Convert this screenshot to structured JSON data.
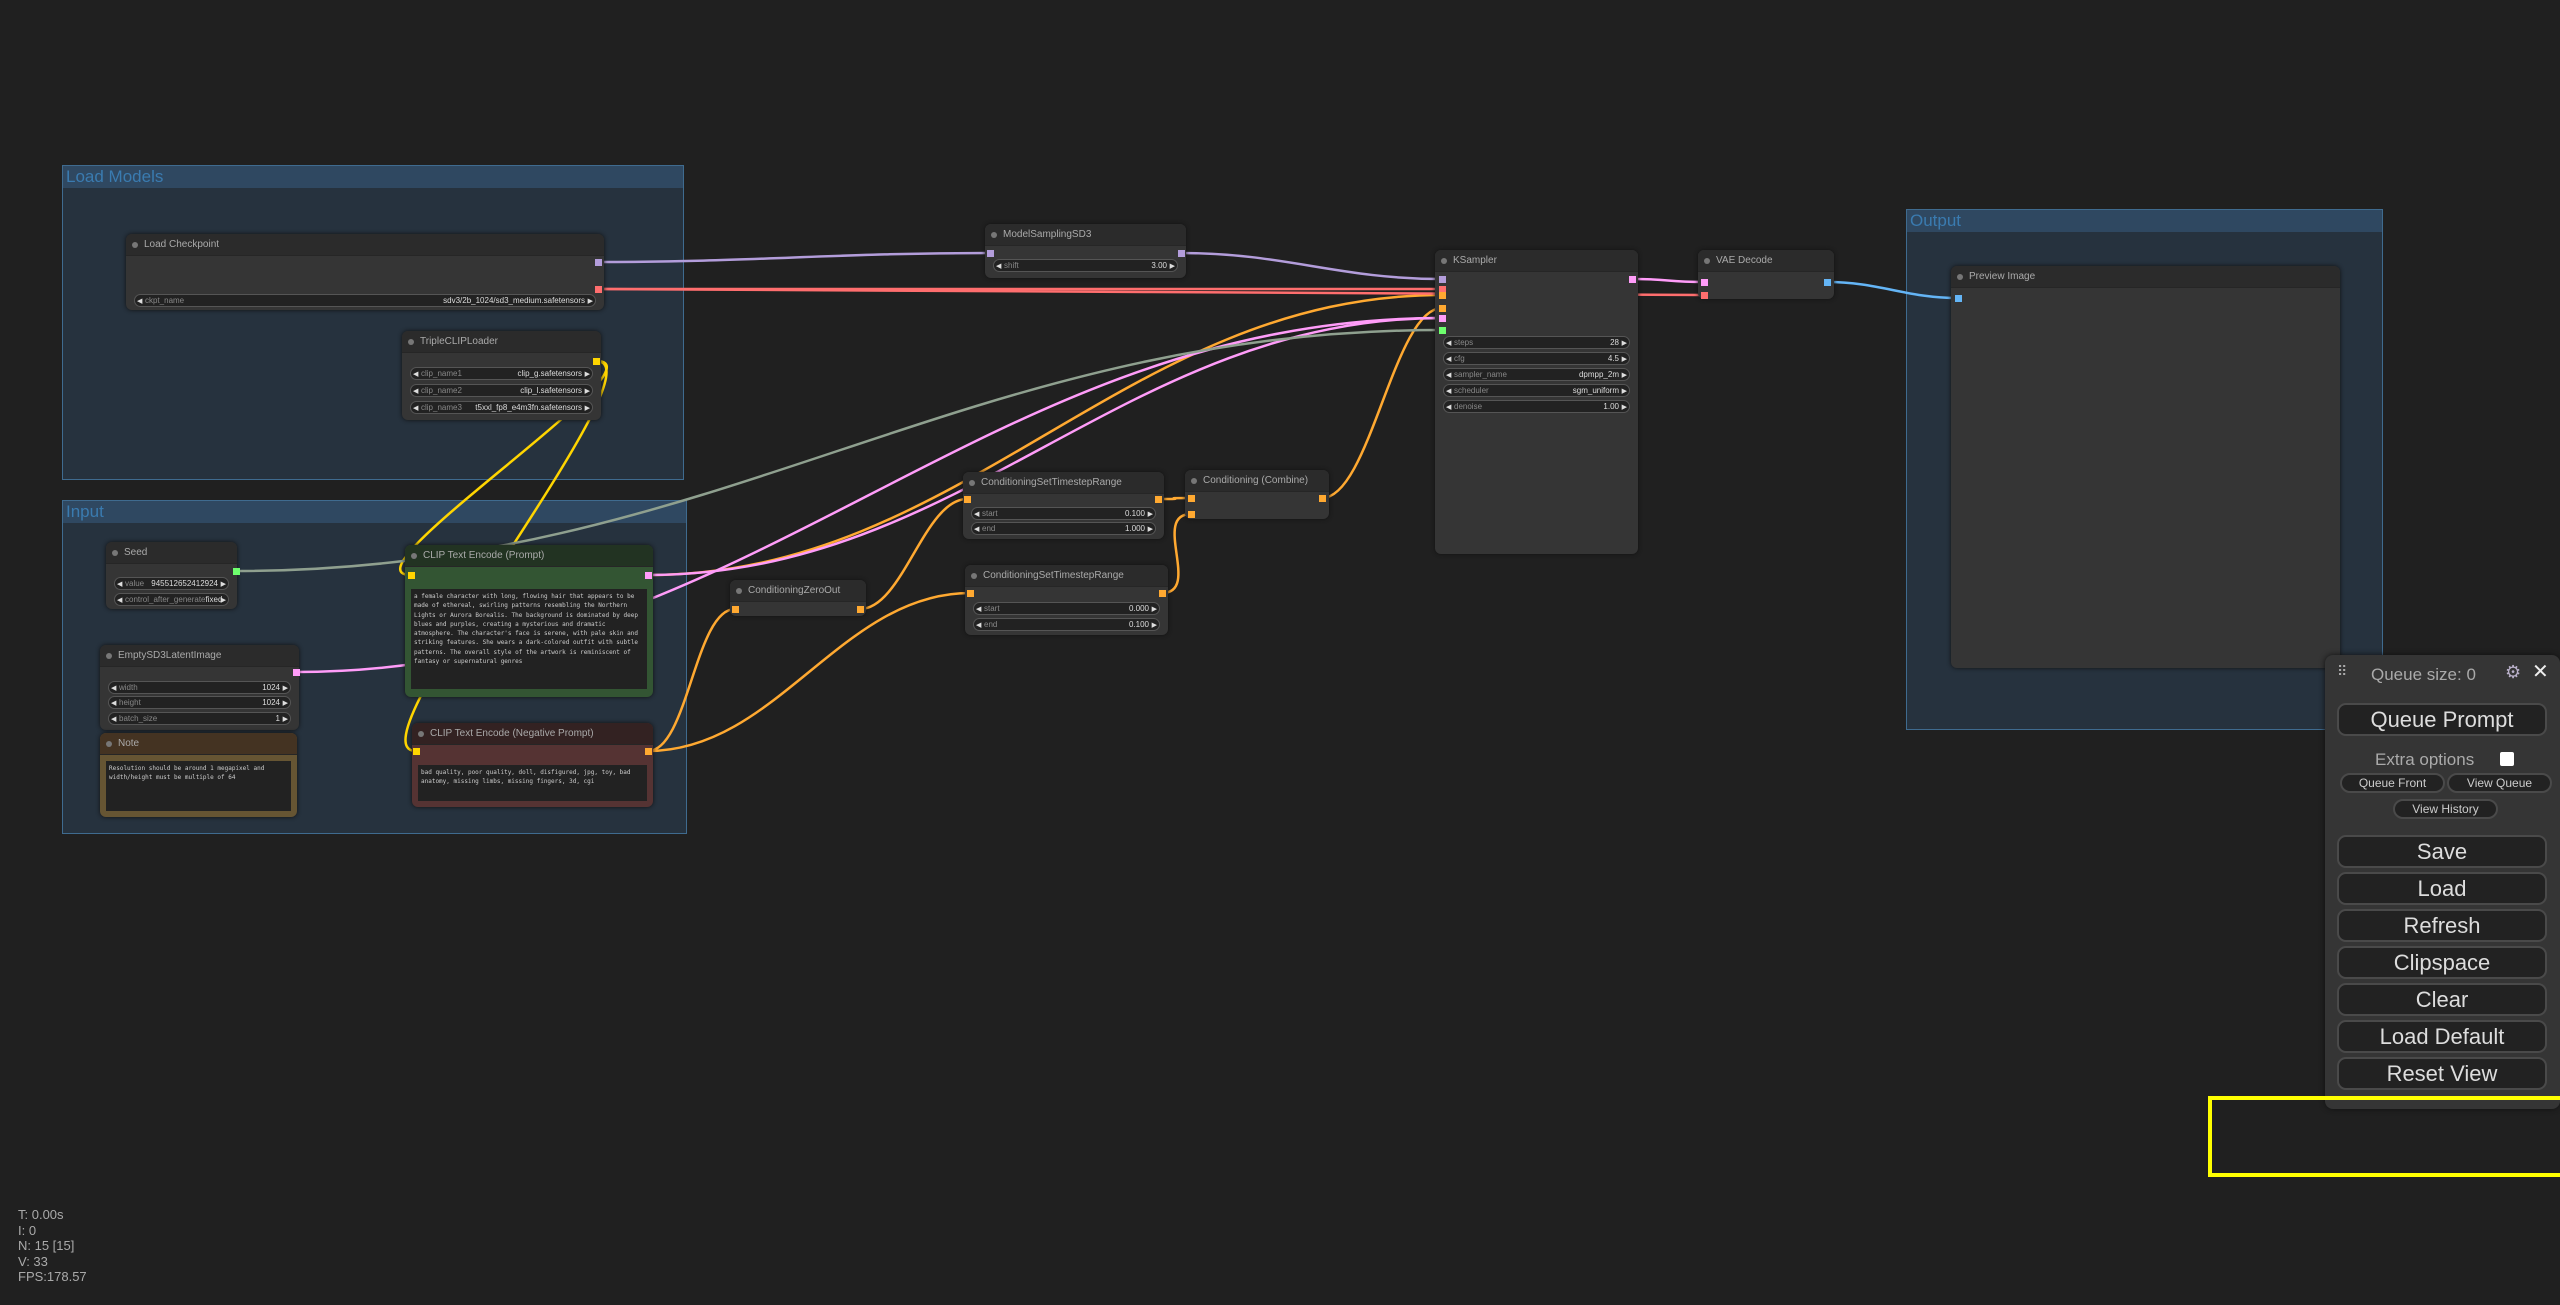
{
  "groups": {
    "load_models": "Load Models",
    "input": "Input",
    "output": "Output"
  },
  "nodes": {
    "load_checkpoint": {
      "title": "Load Checkpoint",
      "ckpt_name_label": "ckpt_name",
      "ckpt_name": "sdv3/2b_1024/sd3_medium.safetensors"
    },
    "triple_clip": {
      "title": "TripleCLIPLoader",
      "clip_name1_label": "clip_name1",
      "clip_name1": "clip_g.safetensors",
      "clip_name2_label": "clip_name2",
      "clip_name2": "clip_l.safetensors",
      "clip_name3_label": "clip_name3",
      "clip_name3": "t5xxl_fp8_e4m3fn.safetensors"
    },
    "seed": {
      "title": "Seed",
      "value_label": "value",
      "value": "945512652412924",
      "control_label": "control_after_generate",
      "control": "fixed"
    },
    "empty_latent": {
      "title": "EmptySD3LatentImage",
      "width_label": "width",
      "width": "1024",
      "height_label": "height",
      "height": "1024",
      "batch_label": "batch_size",
      "batch": "1"
    },
    "note": {
      "title": "Note",
      "text": "Resolution should be around 1 megapixel and width/height must be multiple of 64"
    },
    "clip_pos": {
      "title": "CLIP Text Encode (Prompt)",
      "text": "a female character with long, flowing hair that appears to be made of ethereal, swirling patterns resembling the Northern Lights or Aurora Borealis. The background is dominated by deep blues and purples, creating a mysterious and dramatic atmosphere. The character's face is serene, with pale skin and striking features. She wears a dark-colored outfit with subtle patterns. The overall style of the artwork is reminiscent of fantasy or supernatural genres"
    },
    "clip_neg": {
      "title": "CLIP Text Encode (Negative Prompt)",
      "text": "bad quality, poor quality, doll, disfigured, jpg, toy, bad anatomy, missing limbs, missing fingers, 3d, cgi"
    },
    "model_sampling": {
      "title": "ModelSamplingSD3",
      "shift_label": "shift",
      "shift": "3.00"
    },
    "ksampler": {
      "title": "KSampler",
      "steps_label": "steps",
      "steps": "28",
      "cfg_label": "cfg",
      "cfg": "4.5",
      "sampler_label": "sampler_name",
      "sampler": "dpmpp_2m",
      "scheduler_label": "scheduler",
      "scheduler": "sgm_uniform",
      "denoise_label": "denoise",
      "denoise": "1.00"
    },
    "zero_out": {
      "title": "ConditioningZeroOut"
    },
    "cstr1": {
      "title": "ConditioningSetTimestepRange",
      "start_label": "start",
      "start": "0.100",
      "end_label": "end",
      "end": "1.000"
    },
    "cstr2": {
      "title": "ConditioningSetTimestepRange",
      "start_label": "start",
      "start": "0.000",
      "end_label": "end",
      "end": "0.100"
    },
    "combine": {
      "title": "Conditioning (Combine)"
    },
    "vae_decode": {
      "title": "VAE Decode"
    },
    "preview": {
      "title": "Preview Image"
    }
  },
  "colors": {
    "model": "#b39ddb",
    "clip": "#ffd500",
    "vae": "#ff6e6e",
    "conditioning": "#ffa931",
    "latent": "#ff9cf9",
    "int": "#6eff6e",
    "image": "#64b5f6",
    "highlight": "#ffff00"
  },
  "panel": {
    "queue_size": "Queue size: 0",
    "queue_prompt": "Queue Prompt",
    "extra_options": "Extra options",
    "queue_front": "Queue Front",
    "view_queue": "View Queue",
    "view_history": "View History",
    "save": "Save",
    "load": "Load",
    "refresh": "Refresh",
    "clipspace": "Clipspace",
    "clear": "Clear",
    "load_default": "Load Default",
    "reset_view": "Reset View"
  },
  "stats": {
    "t": "T: 0.00s",
    "i": "I: 0",
    "n": "N: 15 [15]",
    "v": "V: 33",
    "fps": "FPS:178.57"
  }
}
